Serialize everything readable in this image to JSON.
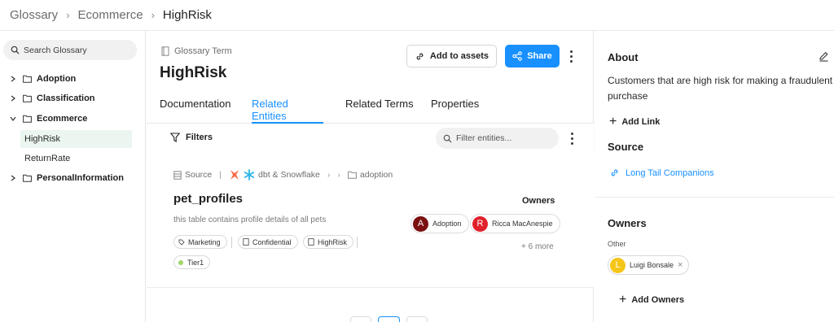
{
  "breadcrumb": {
    "items": [
      "Glossary",
      "Ecommerce",
      "HighRisk"
    ]
  },
  "sidebar": {
    "search_label": "Search Glossary",
    "tree": [
      {
        "label": "Adoption",
        "expanded": false
      },
      {
        "label": "Classification",
        "expanded": false
      },
      {
        "label": "Ecommerce",
        "expanded": true
      },
      {
        "label": "PersonalInformation",
        "expanded": false
      }
    ],
    "children": [
      {
        "label": "HighRisk",
        "active": true
      },
      {
        "label": "ReturnRate",
        "active": false
      }
    ]
  },
  "main": {
    "term_type": "Glossary Term",
    "title": "HighRisk",
    "add_assets_label": "Add to assets",
    "share_label": "Share",
    "tabs": [
      "Documentation",
      "Related Entities",
      "Related Terms",
      "Properties"
    ],
    "active_tab": "Related Entities",
    "filters_label": "Filters",
    "filter_placeholder": "Filter entities...",
    "entity": {
      "source_label": "Source",
      "platform": "dbt & Snowflake",
      "path": "adoption",
      "name": "pet_profiles",
      "description": "this table contains profile details of all pets",
      "owners_label": "Owners",
      "owners": [
        {
          "initial": "A",
          "name": "Adoption",
          "color": "#7a1010"
        },
        {
          "initial": "R",
          "name": "Ricca MacAnespie",
          "color": "#e0202a"
        }
      ],
      "more_owners": "+ 6 more",
      "tags": [
        "Marketing",
        "Confidential",
        "HighRisk"
      ],
      "tier": "Tier1"
    }
  },
  "about": {
    "title": "About",
    "description": "Customers that are high risk for making a fraudulent purchase",
    "add_link_label": "Add Link",
    "source_title": "Source",
    "source_link": "Long Tail Companions",
    "owners_title": "Owners",
    "owners_group": "Other",
    "owner": {
      "initial": "L",
      "name": "Luigi Bonsale"
    },
    "add_owners_label": "Add Owners"
  },
  "colors": {
    "accent": "#1890ff",
    "active_tree_bg": "#eaf6ef"
  }
}
